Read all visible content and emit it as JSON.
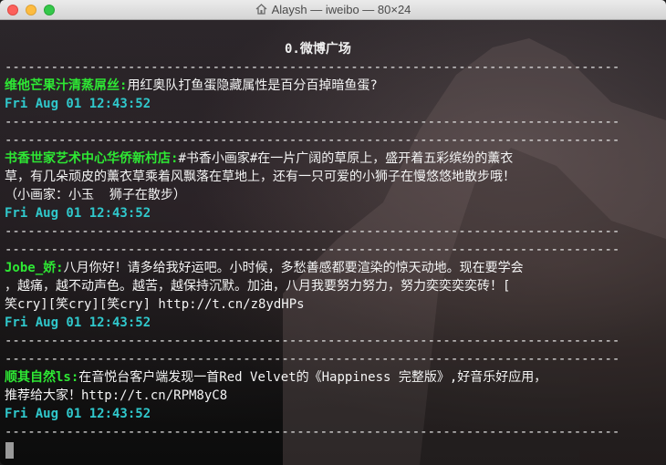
{
  "window": {
    "title": "Alaysh — iweibo — 80×24"
  },
  "header": "0.微博广场",
  "separator": "--------------------------------------------------------------------------------",
  "posts": [
    {
      "user": "维他芒果汁清蒸屌丝:",
      "lines": [
        "用红奥队打鱼蛋隐藏属性是百分百掉暗鱼蛋?"
      ],
      "time": "Fri Aug 01 12:43:52"
    },
    {
      "user": "书香世家艺术中心华侨新村店:",
      "lines": [
        "#书香小画家#在一片广阔的草原上，盛开着五彩缤纷的薰衣",
        "草，有几朵顽皮的薰衣草乘着风飘落在草地上，还有一只可爱的小狮子在慢悠悠地散步哦！",
        "（小画家：小玉  狮子在散步）"
      ],
      "time": "Fri Aug 01 12:43:52"
    },
    {
      "user": "Jobe_娇:",
      "lines": [
        "八月你好！请多给我好运吧。小时候，多愁善感都要渲染的惊天动地。现在要学会",
        "，越痛，越不动声色。越苦，越保持沉默。加油，八月我要努力努力，努力奕奕奕奕砖！[",
        "笑cry][笑cry][笑cry] http://t.cn/z8ydHPs"
      ],
      "time": "Fri Aug 01 12:43:52"
    },
    {
      "user": "顺其自然ls:",
      "lines": [
        "在音悦台客户端发现一首Red Velvet的《Happiness 完整版》,好音乐好应用，",
        "推荐给大家！http://t.cn/RPM8yC8"
      ],
      "time": "Fri Aug 01 12:43:52"
    }
  ]
}
